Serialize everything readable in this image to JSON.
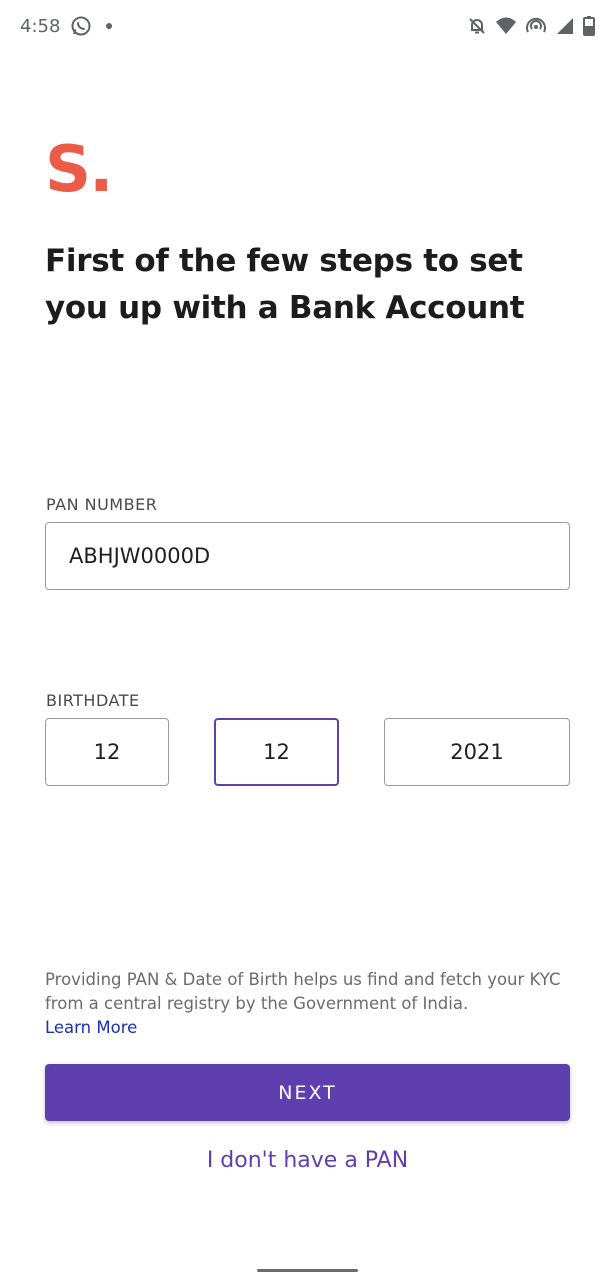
{
  "status_bar": {
    "time": "4:58",
    "left_icons": [
      "whatsapp-icon",
      "notification-dot-icon"
    ],
    "right_icons": [
      "bell-off-icon",
      "wifi-icon",
      "hotspot-icon",
      "cellular-signal-icon",
      "battery-icon"
    ]
  },
  "logo": {
    "text": "S.",
    "color": "#ec5a48"
  },
  "header": {
    "title": "First of the few steps to set you up with a Bank Account"
  },
  "pan": {
    "label": "PAN NUMBER",
    "value": "ABHJW0000D"
  },
  "birthdate": {
    "label": "BIRTHDATE",
    "day": "12",
    "month": "12",
    "year": "2021"
  },
  "info": {
    "text": "Providing PAN & Date of Birth helps us find and fetch your KYC from a central registry by the Government of India.",
    "link": "Learn More"
  },
  "actions": {
    "next_label": "NEXT",
    "no_pan_label": "I don't have a PAN"
  },
  "colors": {
    "accent": "#5f3fb0",
    "brand": "#ec5a48",
    "link": "#1a2fb8"
  }
}
